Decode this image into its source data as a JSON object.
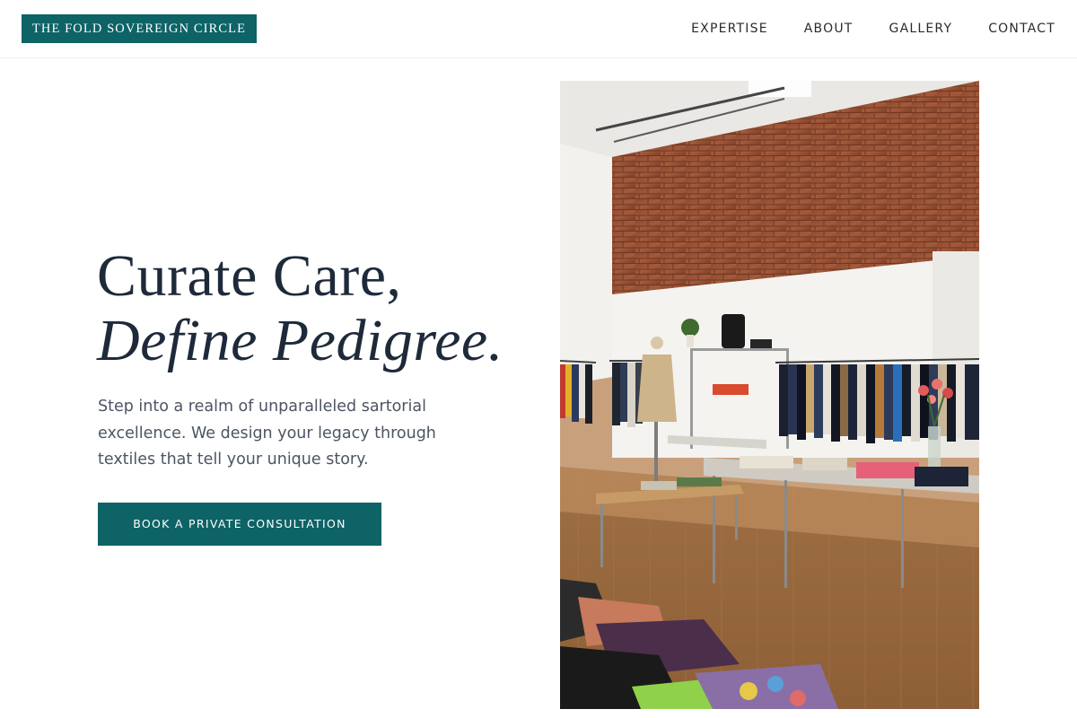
{
  "brand": {
    "name": "THE FOLD SOVEREIGN CIRCLE"
  },
  "nav": {
    "items": [
      {
        "label": "EXPERTISE"
      },
      {
        "label": "ABOUT"
      },
      {
        "label": "GALLERY"
      },
      {
        "label": "CONTACT"
      }
    ]
  },
  "hero": {
    "heading_line_1": "Curate Care,",
    "heading_line_2": "Define Pedigree.",
    "subtext": "Step into a realm of unparalleled sartorial excellence. We design your legacy through textiles that tell your unique story.",
    "cta_label": "BOOK A PRIVATE CONSULTATION",
    "photo_icon": "boutique-interior-photo"
  },
  "colors": {
    "accent": "#0d6366",
    "heading": "#1e2a3a",
    "body_text": "#4c5562",
    "nav_text": "#2b2b2b",
    "background": "#ffffff"
  }
}
